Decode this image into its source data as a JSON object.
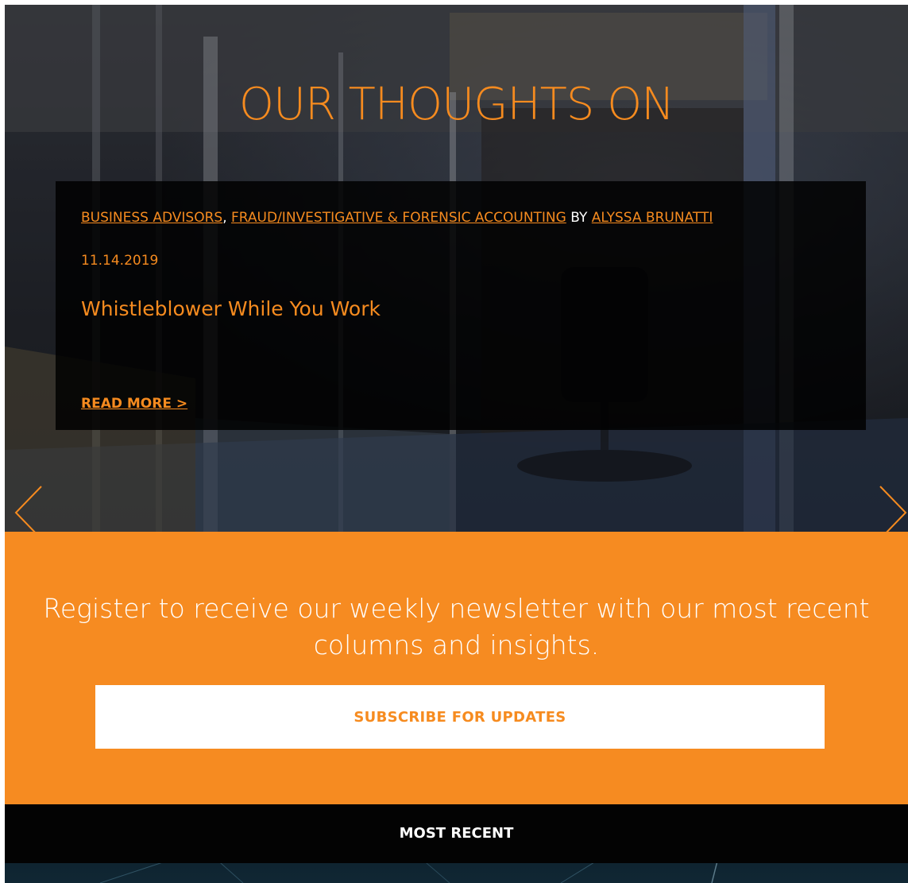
{
  "hero": {
    "title": "OUR THOUGHTS ON"
  },
  "post": {
    "categories": [
      {
        "label": "BUSINESS ADVISORS"
      },
      {
        "label": "FRAUD/INVESTIGATIVE & FORENSIC ACCOUNTING"
      }
    ],
    "separator": ",",
    "by_label": "BY",
    "author": "ALYSSA BRUNATTI",
    "date": "11.14.2019",
    "title": "Whistleblower While You Work",
    "read_more": "READ MORE >"
  },
  "carousel": {
    "prev_icon": "chevron-left-icon",
    "next_icon": "chevron-right-icon"
  },
  "newsletter": {
    "text": "Register to receive our weekly newsletter with our most recent columns and insights.",
    "button_label": "SUBSCRIBE FOR UPDATES"
  },
  "recent": {
    "label": "MOST RECENT"
  },
  "colors": {
    "accent": "#f68b1f",
    "newsletter_bg": "#f68b21",
    "card_bg": "#000000",
    "bar_bg": "#030303"
  }
}
